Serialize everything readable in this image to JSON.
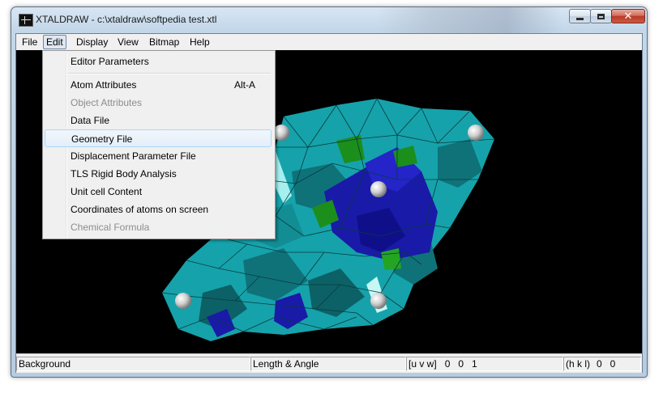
{
  "window": {
    "title": "XTALDRAW - c:\\xtaldraw\\softpedia test.xtl",
    "controls": {
      "minimize": "–",
      "maximize": "□",
      "close": "✕"
    }
  },
  "menubar": {
    "items": [
      "File",
      "Edit",
      "Display",
      "View",
      "Bitmap",
      "Help"
    ],
    "active": "Edit"
  },
  "edit_menu": {
    "items": [
      {
        "label": "Editor Parameters",
        "shortcut": "",
        "disabled": false
      },
      {
        "label": "Atom Attributes",
        "shortcut": "Alt-A",
        "disabled": false
      },
      {
        "label": "Object Attributes",
        "shortcut": "",
        "disabled": true
      },
      {
        "label": "Data File",
        "shortcut": "",
        "disabled": false
      },
      {
        "label": "Geometry File",
        "shortcut": "",
        "disabled": false,
        "highlighted": true
      },
      {
        "label": "Displacement Parameter File",
        "shortcut": "",
        "disabled": false
      },
      {
        "label": "TLS Rigid Body Analysis",
        "shortcut": "",
        "disabled": false
      },
      {
        "label": "Unit cell Content",
        "shortcut": "",
        "disabled": false
      },
      {
        "label": "Coordinates of atoms on screen",
        "shortcut": "",
        "disabled": false
      },
      {
        "label": "Chemical Formula",
        "shortcut": "",
        "disabled": true
      }
    ]
  },
  "statusbar": {
    "mode": "Background",
    "tool": "Length & Angle",
    "uvw_label": "[u v w]",
    "uvw_values": "0   0   1",
    "hkl_label": "(h k l)",
    "hkl_values": "0   0"
  },
  "colors": {
    "polyhedra_teal": "#18a6ad",
    "polyhedra_dark_teal": "#0d6f74",
    "polyhedra_blue": "#1717b5",
    "polyhedra_green": "#1a8a1a",
    "atom_sphere": "#d9d9d9",
    "background": "#000000"
  }
}
